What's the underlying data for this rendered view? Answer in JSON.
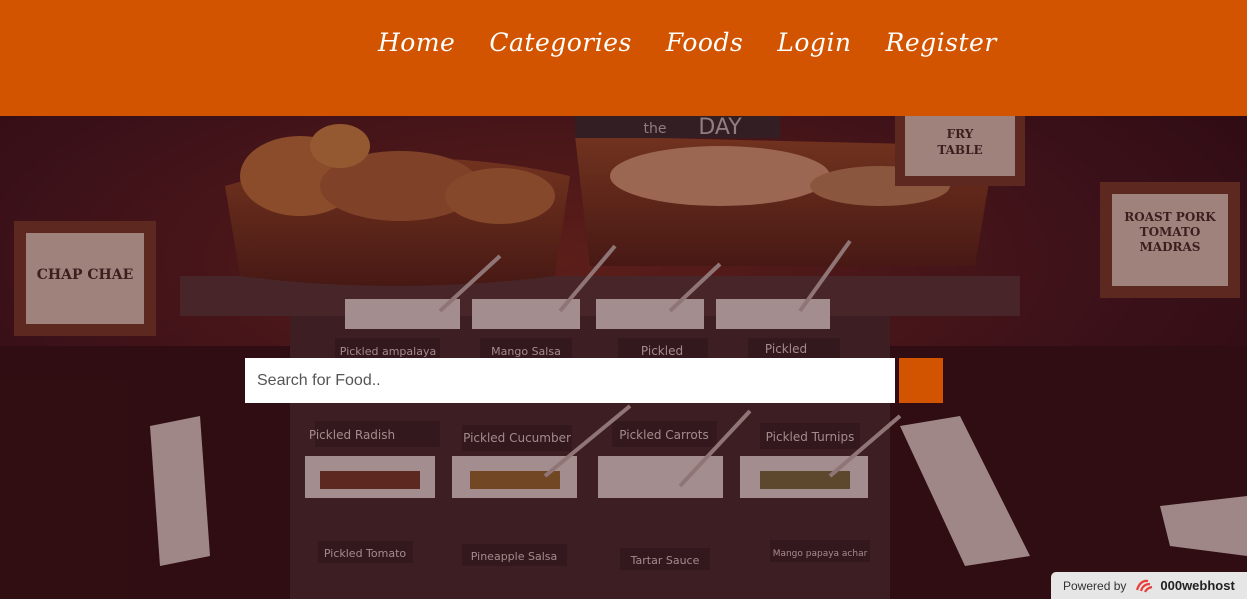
{
  "nav": {
    "items": [
      {
        "label": "Home"
      },
      {
        "label": "Categories"
      },
      {
        "label": "Foods"
      },
      {
        "label": "Login"
      },
      {
        "label": "Register"
      }
    ]
  },
  "hero": {
    "signs": {
      "left": "CHAP CHAE",
      "right_line1": "ROAST PORK",
      "right_line2": "TOMATO",
      "right_line3": "MADRAS",
      "top_right_line1": "FRY",
      "top_right_line2": "TABLE",
      "top_center_small": "the",
      "top_center_big": "DAY"
    },
    "labels": {
      "row1": [
        "Pickled ampalaya",
        "Mango Salsa",
        "Pickled",
        "Pickled"
      ],
      "row2": [
        "Pickled Radish",
        "Pickled Cucumber",
        "Pickled Carrots",
        "Pickled Turnips"
      ],
      "row3": [
        "Pickled Tomato",
        "Pineapple Salsa",
        "Tartar Sauce",
        "Mango papaya achar"
      ]
    }
  },
  "search": {
    "placeholder": "Search for Food..",
    "value": ""
  },
  "badge": {
    "prefix": "Powered by",
    "brand": "000webhost"
  },
  "colors": {
    "primary": "#d35400",
    "nav_text": "#ffffff"
  }
}
